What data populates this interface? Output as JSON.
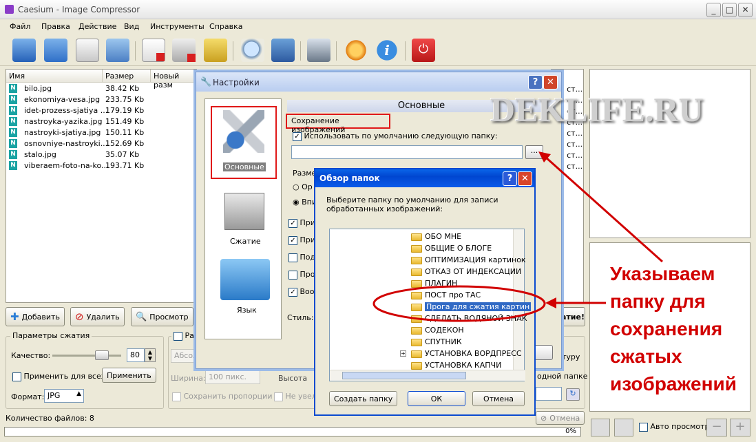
{
  "app": {
    "title": "Caesium - Image Compressor"
  },
  "menu": [
    "Файл",
    "Правка",
    "Действие",
    "Вид",
    "Инструменты",
    "Справка"
  ],
  "filelist": {
    "headers": [
      "Имя",
      "Размер",
      "Новый разм"
    ],
    "rows": [
      {
        "name": "bilo.jpg",
        "size": "38.42 Kb"
      },
      {
        "name": "ekonomiya-vesa.jpg",
        "size": "233.75 Kb"
      },
      {
        "name": "idet-prozess-sjatiya ...",
        "size": "179.19 Kb"
      },
      {
        "name": "nastroyka-yazika.jpg",
        "size": "151.49 Kb"
      },
      {
        "name": "nastroyki-sjatiya.jpg",
        "size": "150.11 Kb"
      },
      {
        "name": "osnovniye-nastroyki....",
        "size": "152.69 Kb"
      },
      {
        "name": "stalo.jpg",
        "size": "35.07 Kb"
      },
      {
        "name": "viberaem-foto-na-ko...",
        "size": "193.71 Kb"
      }
    ]
  },
  "right_col": [
    "я ст...",
    "я ст...",
    "я ст...",
    "я ст...",
    "я ст...",
    "я ст...",
    "я ст...",
    "я ст..."
  ],
  "buttons": {
    "add": "Добавить",
    "remove": "Удалить",
    "preview": "Просмотр",
    "apply": "Применить",
    "cancel": "Отмена",
    "ready": "атие!"
  },
  "compress": {
    "group": "Параметры сжатия",
    "quality_label": "Качество:",
    "quality": "80",
    "apply_all": "Применить для всех",
    "format_label": "Формат:",
    "format": "JPG",
    "resize": "Разм",
    "absolute": "Абсолю",
    "width_label": "Ширина:",
    "width": "100 пикс.",
    "height_label": "Высота",
    "keep_props": "Сохранить пропорции",
    "no_enlarge": "Не увели",
    "tura": "туру",
    "output_folder": "одной папке"
  },
  "status": {
    "count": "Количество файлов: 8",
    "percent": "0%",
    "auto_preview": "Авто просмотр"
  },
  "settings": {
    "title": "Настройки",
    "nav": [
      "Основные",
      "Сжатие",
      "Язык"
    ],
    "heading": "Основные",
    "save_images": "Сохранение изображений",
    "use_default": "Использовать по умолчанию следующую папку:",
    "browse": "...",
    "size_lbl": "Размер",
    "opt1": "Ор",
    "opt2": "Впи",
    "chk": [
      "При",
      "При",
      "Под",
      "Про",
      "Воо"
    ],
    "style": "Стиль:"
  },
  "browse": {
    "title": "Обзор папок",
    "desc": "Выберите папку по умолчанию для записи обработанных изображений:",
    "items": [
      "ОБО МНЕ",
      "ОБЩИЕ О БЛОГЕ",
      "ОПТИМИЗАЦИЯ картинок",
      "ОТКАЗ ОТ ИНДЕКСАЦИИ",
      "ПЛАГИН",
      "ПОСТ про ТАС",
      "Прога для сжатия картин",
      "СДЕЛАТЬ ВОДЯНОЙ ЗНАК",
      "СОДЕКОН",
      "СПУТНИК",
      "УСТАНОВКА ВОРДПРЕСС",
      "УСТАНОВКА КАПЧИ"
    ],
    "create": "Создать папку",
    "ok": "ОК",
    "cancel": "Отмена"
  },
  "watermark": "DEKLIFE.RU",
  "annotation": [
    "Указываем",
    "папку для",
    "сохранения",
    "сжатых",
    "изображений"
  ],
  "colors": {
    "accent": "#0a5ae0",
    "annotation": "#d10000"
  }
}
